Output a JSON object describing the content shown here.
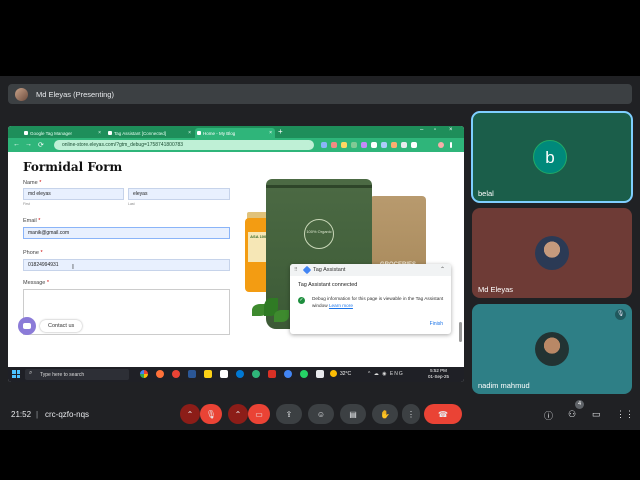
{
  "presenter_bar": {
    "label": "Md Eleyas (Presenting)"
  },
  "browser": {
    "tabs": [
      {
        "label": "Google Tag Manager",
        "close": "×"
      },
      {
        "label": "Tag Assistant [Connected]",
        "close": "×"
      },
      {
        "label": "Home - My Blog",
        "close": "×"
      }
    ],
    "new_tab": "+",
    "window_controls": [
      "–",
      "▫",
      "×"
    ],
    "nav": {
      "back": "←",
      "forward": "→",
      "reload": "⟳"
    },
    "url": "online-store.eleyas.com/?gtm_debug=1758741800783",
    "accent": "#2fb57a"
  },
  "page": {
    "title": "Formidal Form",
    "name_label": "Name",
    "required_mark": "*",
    "first_value": "md eleyas",
    "first_sub": "First",
    "last_value": "eleyas",
    "last_sub": "Last",
    "email_label": "Email",
    "email_value": "manik@gmail.com",
    "phone_label": "Phone",
    "phone_value": "01824994931",
    "message_label": "Message",
    "contact_button": "Contact us",
    "product": {
      "jar_label": "ASA 100%",
      "bag_front_badge": "100% Organic",
      "bag_front_name": "VEGGIES",
      "bag_back_name": "GROCERIES"
    }
  },
  "tag_assistant": {
    "title": "Tag Assistant",
    "status": "Tag Assistant connected",
    "description": "Debug information for this page is viewable in the Tag Assistant window",
    "learn_more": "Learn more",
    "finish": "Finish"
  },
  "taskbar": {
    "search_placeholder": "Type here to search",
    "weather": "32°C",
    "tray": "^ ☁ ◉ ENG",
    "time": "5:52 PM",
    "date": "01-Sep-25"
  },
  "participants": [
    {
      "name": "belal",
      "initial": "b",
      "color": "#1b5e4a"
    },
    {
      "name": "Md Eleyas",
      "color": "#6e3b36"
    },
    {
      "name": "nadim mahmud",
      "color": "#2e7f86"
    }
  ],
  "bottom_bar": {
    "time": "21:52",
    "separator": "|",
    "meeting_code": "crc-qzfo-nqs",
    "participant_count": "4"
  }
}
